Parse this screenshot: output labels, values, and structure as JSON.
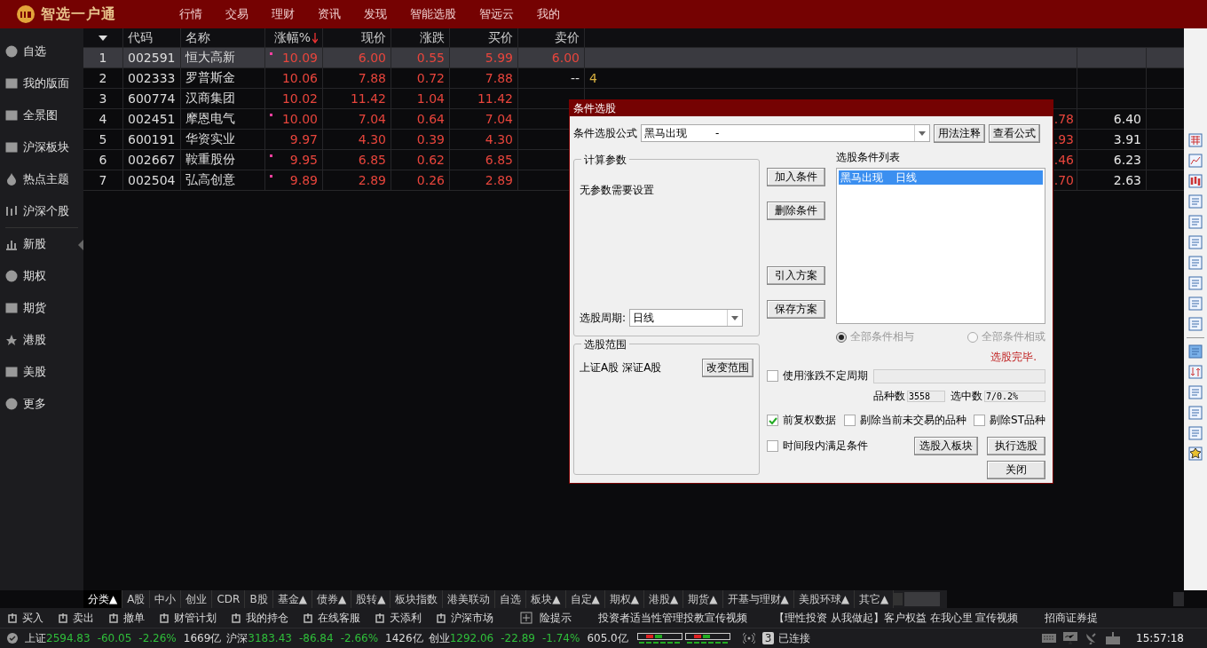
{
  "app": {
    "name": "智选一户通"
  },
  "menu": [
    "行情",
    "交易",
    "理财",
    "资讯",
    "发现",
    "智能选股",
    "智远云",
    "我的"
  ],
  "sidebar": {
    "items": [
      {
        "label": "自选"
      },
      {
        "label": "我的版面"
      },
      {
        "label": "全景图"
      },
      {
        "label": "沪深板块"
      },
      {
        "label": "热点主题"
      },
      {
        "label": "沪深个股"
      },
      {
        "label": "新股"
      },
      {
        "label": "期权"
      },
      {
        "label": "期货"
      },
      {
        "label": "港股"
      },
      {
        "label": "美股"
      },
      {
        "label": "更多"
      }
    ]
  },
  "table": {
    "columns": [
      {
        "label": "代码",
        "sorted": false
      },
      {
        "label": "名称",
        "sorted": false
      },
      {
        "label": "涨幅%",
        "sorted": true
      },
      {
        "label": "现价",
        "sorted": false
      },
      {
        "label": "涨跌",
        "sorted": false
      },
      {
        "label": "买价",
        "sorted": false
      },
      {
        "label": "卖价",
        "sorted": false
      }
    ],
    "rows": [
      {
        "no": "1",
        "code": "002591",
        "name": "恒大高新",
        "flag": true,
        "pct": "10.09",
        "price": "6.00",
        "change": "0.55",
        "bid": "5.99",
        "ask": "6.00",
        "ask_up": true,
        "selected": true
      },
      {
        "no": "2",
        "code": "002333",
        "name": "罗普斯金",
        "flag": false,
        "pct": "10.06",
        "price": "7.88",
        "change": "0.72",
        "bid": "7.88",
        "ask": "--",
        "ask_up": false,
        "col_9": "4",
        "selected": false
      },
      {
        "no": "3",
        "code": "600774",
        "name": "汉商集团",
        "flag": false,
        "pct": "10.02",
        "price": "11.42",
        "change": "1.04",
        "bid": "11.42",
        "selected": false
      },
      {
        "no": "4",
        "code": "002451",
        "name": "摩恩电气",
        "flag": true,
        "pct": "10.00",
        "price": "7.04",
        "change": "0.64",
        "bid": "7.04",
        "col_r1": ".78",
        "col_r2": "6.40",
        "selected": false
      },
      {
        "no": "5",
        "code": "600191",
        "name": "华资实业",
        "flag": false,
        "pct": "9.97",
        "price": "4.30",
        "change": "0.39",
        "bid": "4.30",
        "col_r1": ".93",
        "col_r2": "3.91",
        "selected": false
      },
      {
        "no": "6",
        "code": "002667",
        "name": "鞍重股份",
        "flag": true,
        "pct": "9.95",
        "price": "6.85",
        "change": "0.62",
        "bid": "6.85",
        "col_r1": ".46",
        "col_r2": "6.23",
        "selected": false
      },
      {
        "no": "7",
        "code": "002504",
        "name": "弘高创意",
        "flag": true,
        "pct": "9.89",
        "price": "2.89",
        "change": "0.26",
        "bid": "2.89",
        "col_r1": ".70",
        "col_r2": "2.63",
        "selected": false
      }
    ]
  },
  "dialog": {
    "title": "条件选股",
    "formula_label": "条件选股公式",
    "formula_value": "黑马出现",
    "formula_suffix": "-",
    "buttons_top": [
      "用法注释",
      "查看公式"
    ],
    "params_group": "计算参数",
    "params_text": "无参数需要设置",
    "period_label": "选股周期:",
    "period_value": "日线",
    "scope_group": "选股范围",
    "scope_items": [
      "上证A股",
      "深证A股"
    ],
    "scope_button": "改变范围",
    "mid_buttons": [
      "加入条件",
      "删除条件",
      "引入方案",
      "保存方案"
    ],
    "list_label": "选股条件列表",
    "list_items": [
      {
        "name": "黑马出现",
        "period": "日线",
        "selected": true
      }
    ],
    "radios": [
      {
        "label": "全部条件相与",
        "selected": true,
        "disabled": true
      },
      {
        "label": "全部条件相或",
        "selected": false,
        "disabled": true
      }
    ],
    "status": "选股完毕.",
    "variable_period": {
      "label": "使用涨跌不定周期",
      "checked": false
    },
    "count_label": "品种数",
    "count_value": "3558",
    "picked_label": "选中数",
    "picked_value": "7/0.2%",
    "options": [
      {
        "label": "前复权数据",
        "checked": true
      },
      {
        "label": "剔除当前未交易的品种",
        "checked": false
      },
      {
        "label": "剔除ST品种",
        "checked": false
      }
    ],
    "period_option": {
      "label": "时间段内满足条件",
      "checked": false
    },
    "bottom_buttons": [
      "选股入板块",
      "执行选股"
    ],
    "close_button": "关闭"
  },
  "bottom_tabs": [
    {
      "label": "分类▲",
      "selected": true
    },
    {
      "label": "A股",
      "selected": false
    },
    {
      "label": "中小",
      "selected": false
    },
    {
      "label": "创业",
      "selected": false
    },
    {
      "label": "CDR",
      "selected": false
    },
    {
      "label": "B股",
      "selected": false
    },
    {
      "label": "基金▲",
      "selected": false
    },
    {
      "label": "债券▲",
      "selected": false
    },
    {
      "label": "股转▲",
      "selected": false
    },
    {
      "label": "板块指数",
      "selected": false
    },
    {
      "label": "港美联动",
      "selected": false
    },
    {
      "label": "自选",
      "selected": false
    },
    {
      "label": "板块▲",
      "selected": false
    },
    {
      "label": "自定▲",
      "selected": false
    },
    {
      "label": "期权▲",
      "selected": false
    },
    {
      "label": "港股▲",
      "selected": false
    },
    {
      "label": "期货▲",
      "selected": false
    },
    {
      "label": "开基与理财▲",
      "selected": false
    },
    {
      "label": "美股环球▲",
      "selected": false
    },
    {
      "label": "其它▲",
      "selected": false
    }
  ],
  "toolbar": [
    "买入",
    "卖出",
    "撤单",
    "财管计划",
    "我的持仓",
    "在线客服",
    "天添利",
    "沪深市场"
  ],
  "ticker": [
    "险提示",
    "投资者适当性管理投教宣传视频",
    "【理性投资 从我做起】客户权益 在我心里 宣传视频",
    "招商证券提"
  ],
  "indices": [
    {
      "name": "上证",
      "value": "2594.83",
      "change": "-60.05",
      "pct": "-2.26%",
      "volume": "1669亿"
    },
    {
      "name": "沪深",
      "value": "3183.43",
      "change": "-86.84",
      "pct": "-2.66%",
      "volume": "1426亿"
    },
    {
      "name": "创业",
      "value": "1292.06",
      "change": "-22.89",
      "pct": "-1.74%",
      "volume": "605.0亿"
    }
  ],
  "connection": {
    "count": "3",
    "label": "已连接"
  },
  "time": "15:57:18"
}
